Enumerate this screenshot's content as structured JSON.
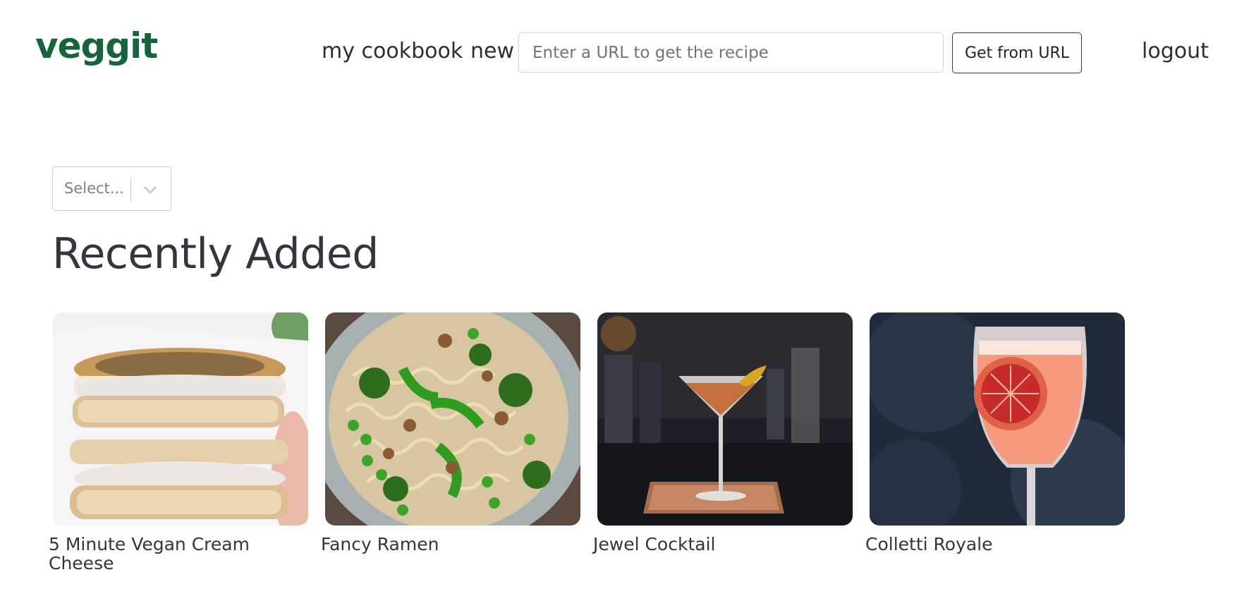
{
  "brand": {
    "name": "veggit"
  },
  "nav": {
    "cookbook": "my cookbook",
    "new": "new",
    "logout": "logout"
  },
  "url_form": {
    "placeholder": "Enter a URL to get the recipe",
    "value": "",
    "button": "Get from URL"
  },
  "filter": {
    "placeholder": "Select..."
  },
  "section": {
    "title": "Recently Added"
  },
  "cards": [
    {
      "title": "5 Minute Vegan Cream Cheese",
      "image": "bagel-photo"
    },
    {
      "title": "Fancy Ramen",
      "image": "ramen-photo"
    },
    {
      "title": "Jewel Cocktail",
      "image": "martini-photo"
    },
    {
      "title": "Colletti Royale",
      "image": "spritz-photo"
    }
  ],
  "colors": {
    "brand": "#16643a",
    "text": "#33363d",
    "border": "#ced4da"
  }
}
